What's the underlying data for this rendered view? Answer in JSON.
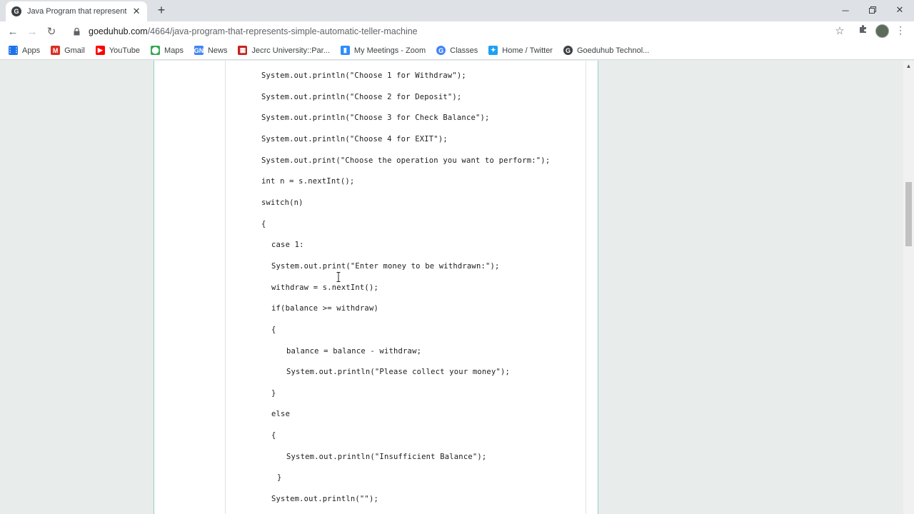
{
  "browser": {
    "tab_title": "Java Program that represents a s",
    "tab_favicon": "G",
    "url_host": "goeduhub.com",
    "url_path": "/4664/java-program-that-represents-simple-automatic-teller-machine"
  },
  "bookmarks": [
    {
      "label": "Apps",
      "icon": "apps-grid-icon",
      "color": "#1a73e8"
    },
    {
      "label": "Gmail",
      "icon": "gmail-icon",
      "color": "#d93025"
    },
    {
      "label": "YouTube",
      "icon": "youtube-icon",
      "color": "#ff0000"
    },
    {
      "label": "Maps",
      "icon": "maps-pin-icon",
      "color": "#34a853"
    },
    {
      "label": "News",
      "icon": "news-icon",
      "color": "#4285f4"
    },
    {
      "label": "Jecrc University::Par...",
      "icon": "jecrc-icon",
      "color": "#c5221f"
    },
    {
      "label": "My Meetings - Zoom",
      "icon": "zoom-icon",
      "color": "#2d8cff"
    },
    {
      "label": "Classes",
      "icon": "google-icon",
      "color": "#4285f4"
    },
    {
      "label": "Home / Twitter",
      "icon": "twitter-icon",
      "color": "#1da1f2"
    },
    {
      "label": "Goeduhub Technol...",
      "icon": "goeduhub-icon",
      "color": "#3c4043"
    }
  ],
  "code_lines": [
    "System.out.println(\"Choose 1 for Withdraw\");",
    "System.out.println(\"Choose 2 for Deposit\");",
    "System.out.println(\"Choose 3 for Check Balance\");",
    "System.out.println(\"Choose 4 for EXIT\");",
    "System.out.print(\"Choose the operation you want to perform:\");",
    "int n = s.nextInt();",
    "switch(n)",
    "{",
    "case 1:",
    "System.out.print(\"Enter money to be withdrawn:\");",
    "withdraw = s.nextInt();",
    "if(balance >= withdraw)",
    "{",
    "balance = balance - withdraw;",
    "System.out.println(\"Please collect your money\");",
    "}",
    "else",
    "{",
    "System.out.println(\"Insufficient Balance\");",
    "}",
    "System.out.println(\"\");"
  ]
}
